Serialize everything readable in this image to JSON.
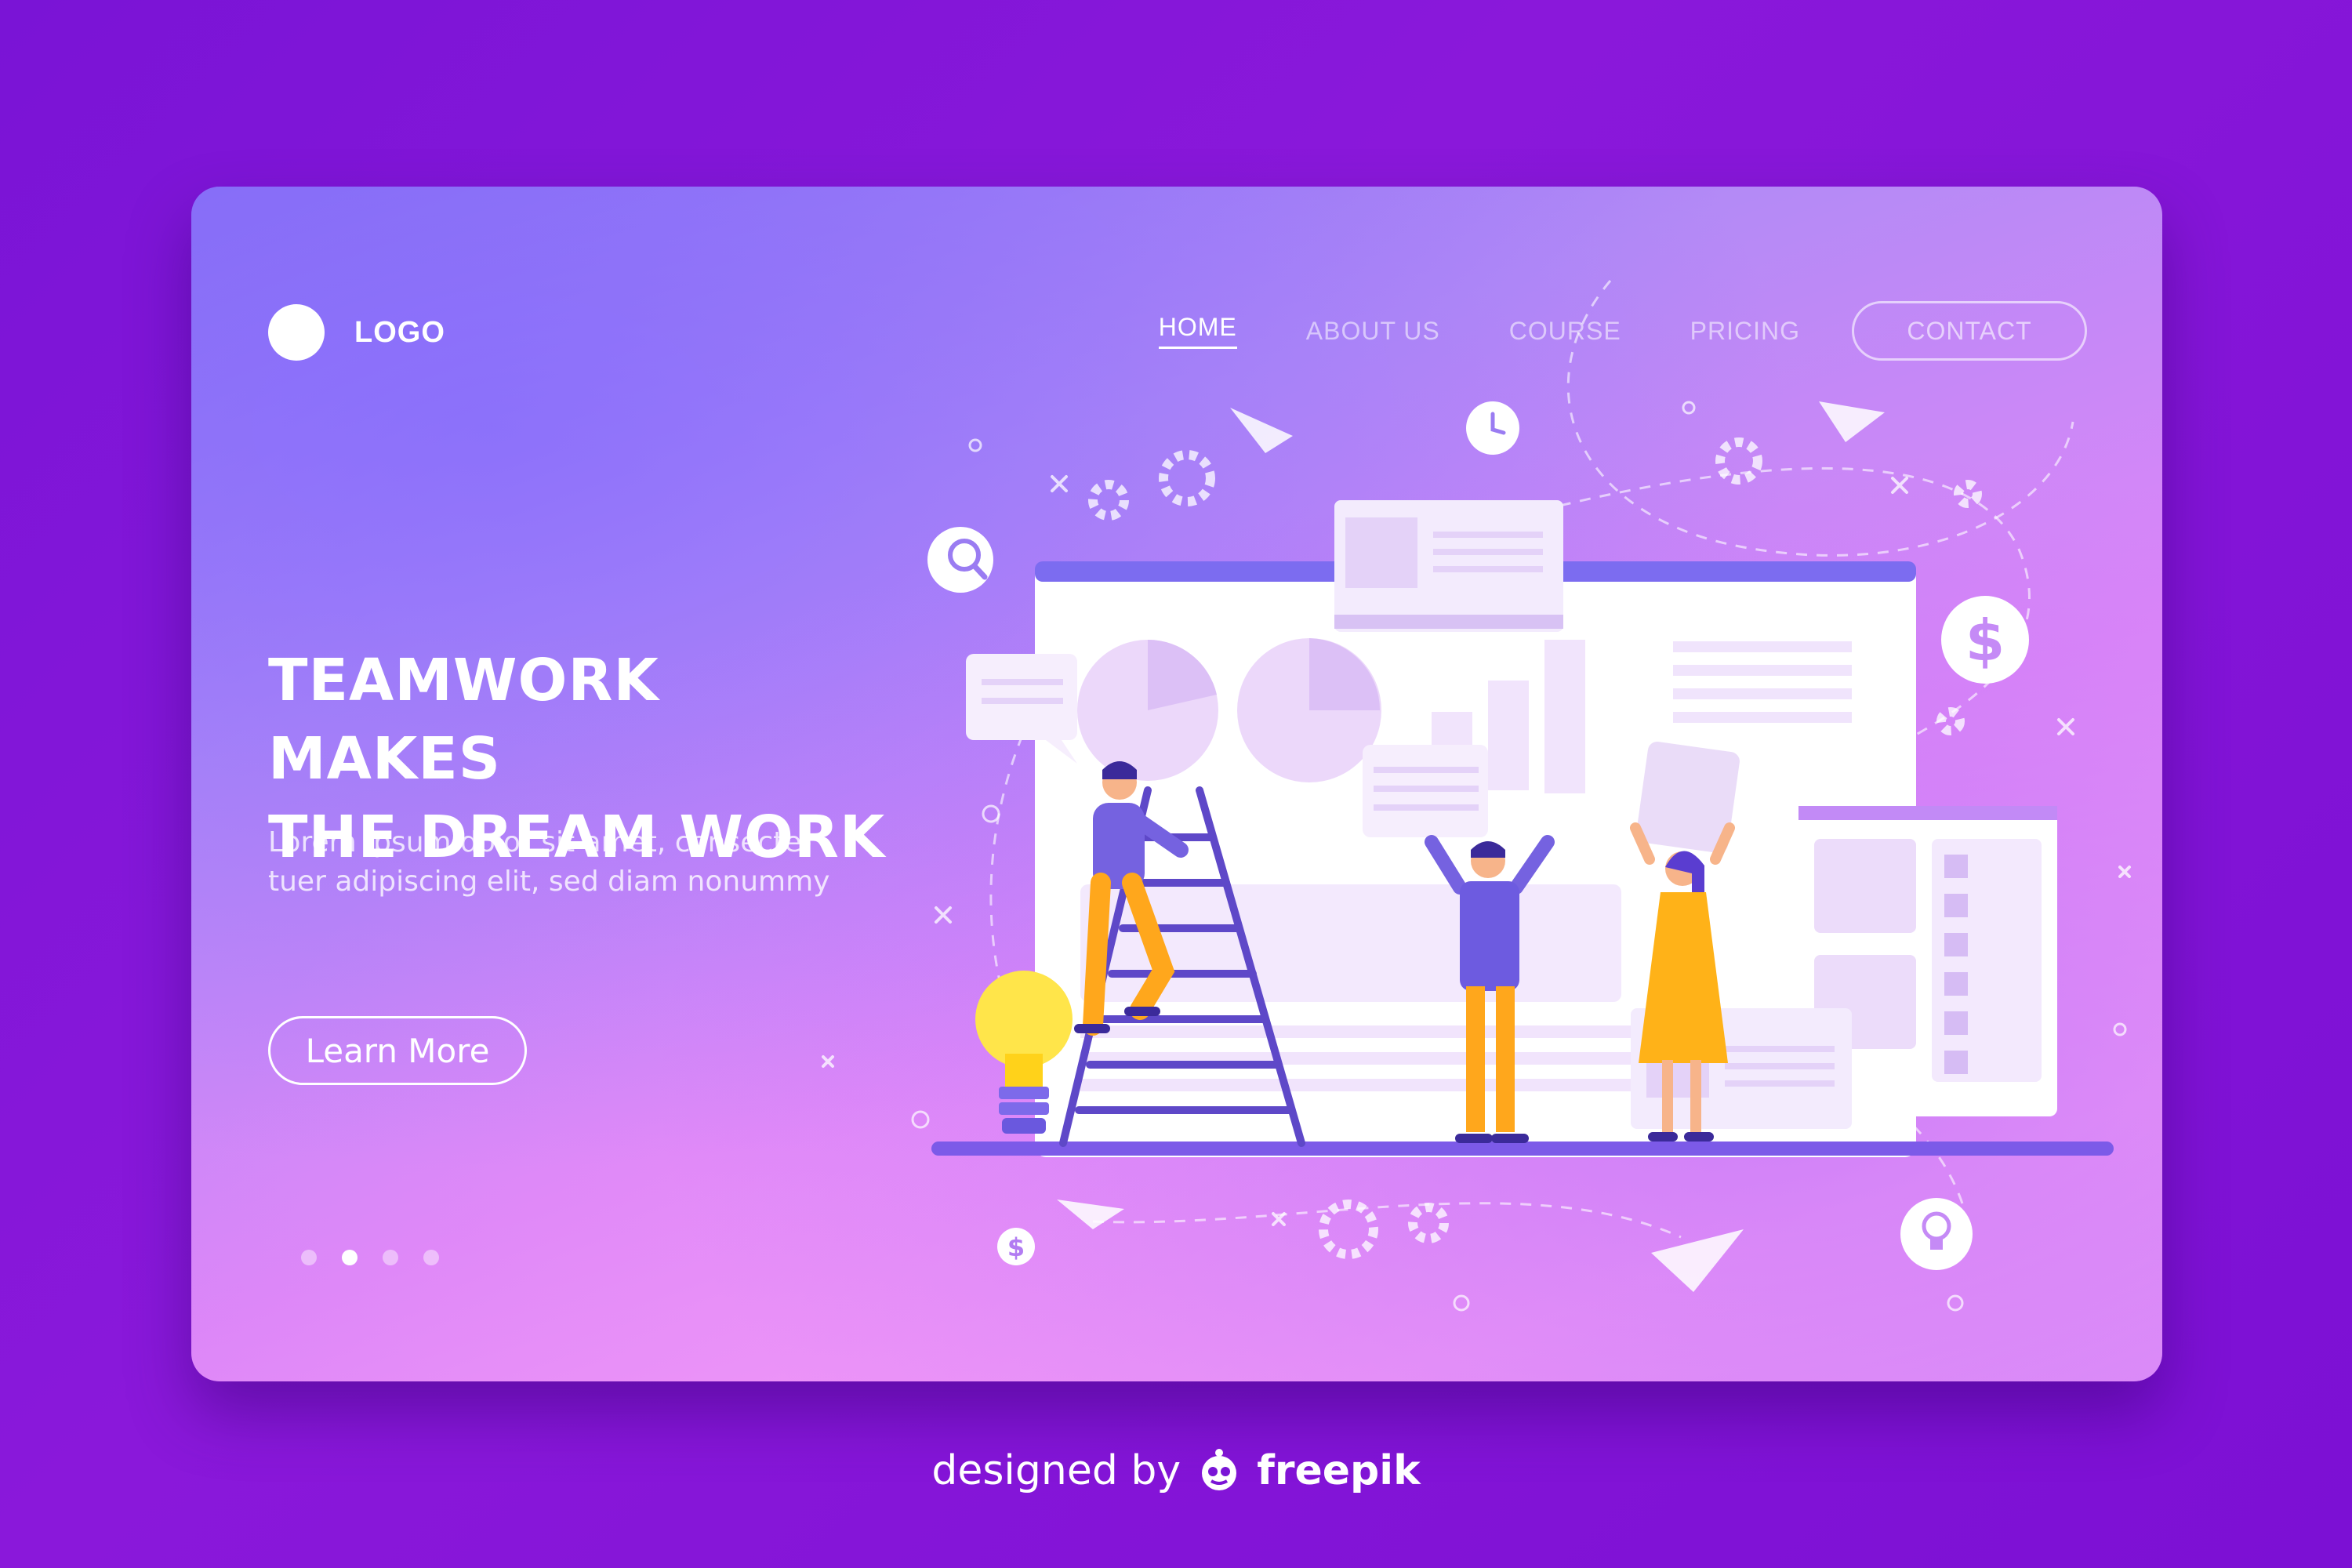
{
  "header": {
    "logo_text": "LOGO",
    "nav": [
      {
        "label": "HOME",
        "active": true
      },
      {
        "label": "ABOUT US",
        "active": false
      },
      {
        "label": "COURSE",
        "active": false
      },
      {
        "label": "PRICING",
        "active": false
      }
    ],
    "contact_label": "CONTACT"
  },
  "hero": {
    "headline_line1": "TEAMWORK MAKES",
    "headline_line2": "THE DREAM WORK",
    "subtext_line1": "Lorem ipsum dolor sit amet, consecte-",
    "subtext_line2": "tuer adipiscing elit, sed diam nonummy",
    "cta_label": "Learn More"
  },
  "carousel": {
    "count": 4,
    "active_index": 1
  },
  "icons": {
    "dollar_glyph": "$",
    "names": [
      "search-icon",
      "clock-icon",
      "dollar-icon",
      "lightbulb-icon",
      "gear-icon",
      "paper-plane-icon"
    ]
  },
  "credit": {
    "prefix": "designed by",
    "brand": "freepik"
  },
  "colors": {
    "card_start": "#8e72f4",
    "card_end": "#f39af6",
    "accent_purple": "#6d5be0",
    "accent_yellow": "#ffb400",
    "background": "#7a14d6"
  }
}
